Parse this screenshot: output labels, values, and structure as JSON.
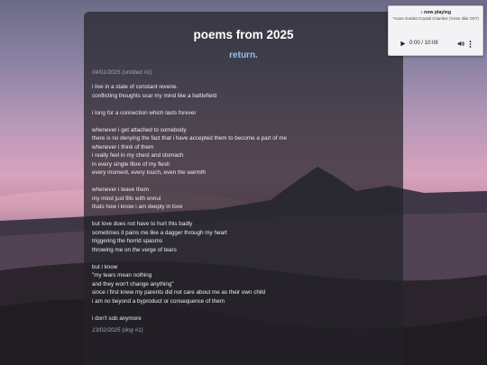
{
  "header": {
    "title": "poems from 2025",
    "return_label": "return."
  },
  "entries": [
    {
      "header": "04/01/2025 (untitled #1)",
      "stanzas": [
        [
          "i live in a state of constant reverie.",
          "conflicting thoughts scar my mind like a battlefield"
        ],
        [
          "i long for a connection which lasts forever"
        ],
        [
          "whenever i get attached to somebody",
          "there is no denying the fact that i have accepted them to become a part of me",
          "whenever i think of them",
          "i really feel in my chest and stomach",
          "in every single fibre of my flesh",
          "every moment, every touch, even the warmth"
        ],
        [
          "whenever i leave them",
          "my mind just fills with ennui",
          "thats how i know i am deeply in love"
        ],
        [
          "but love does not have to hurt this badly",
          "sometimes it pains me like a dagger through my heart",
          "triggering the horrid spasms",
          "throwing me on the verge of tears"
        ],
        [
          "but i know",
          "\"my tears mean nothing",
          "and they won't change anything\"",
          "since i first knew my parents did not care about me as their own child",
          "i am no beyond a byproduct or consequence of them"
        ],
        [
          "i don't sob anymore"
        ]
      ]
    },
    {
      "header": "13/02/2025 (dog #1)",
      "stanzas": []
    }
  ],
  "player": {
    "title": "♪ now playing",
    "track": "\"Azure Garden:Crystal Chamber (Yume 2kki OST)",
    "time": "0:00 / 10:08",
    "icons": {
      "play": "play-icon",
      "volume": "volume-icon",
      "more": "more-options-icon"
    }
  }
}
